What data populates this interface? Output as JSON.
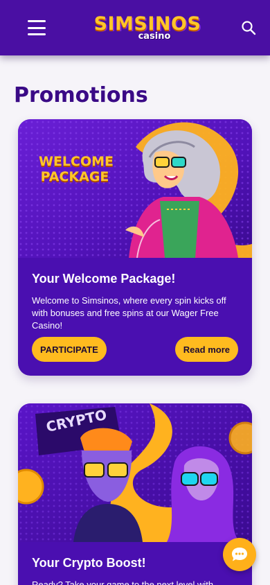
{
  "header": {
    "logo_main": "SIMSINOS",
    "logo_sub": "casino",
    "menu_icon": "hamburger-menu-icon",
    "search_icon": "search-icon",
    "background_color": "#4a0fa3",
    "accent_color": "#ffc629"
  },
  "page": {
    "title": "Promotions"
  },
  "promotions": [
    {
      "banner_text": "WELCOME\nPACKAGE",
      "title": "Your Welcome Package!",
      "description": "Welcome to Simsinos, where every spin kicks off with bonuses and free spins at our Wager Free Casino!",
      "participate_label": "PARTICIPATE",
      "read_more_label": "Read more"
    },
    {
      "banner_text": "CRYPTO",
      "title": "Your Crypto Boost!",
      "description": "Ready? Take your game to the next level with"
    }
  ],
  "chat": {
    "icon": "chat-bubble-icon"
  }
}
